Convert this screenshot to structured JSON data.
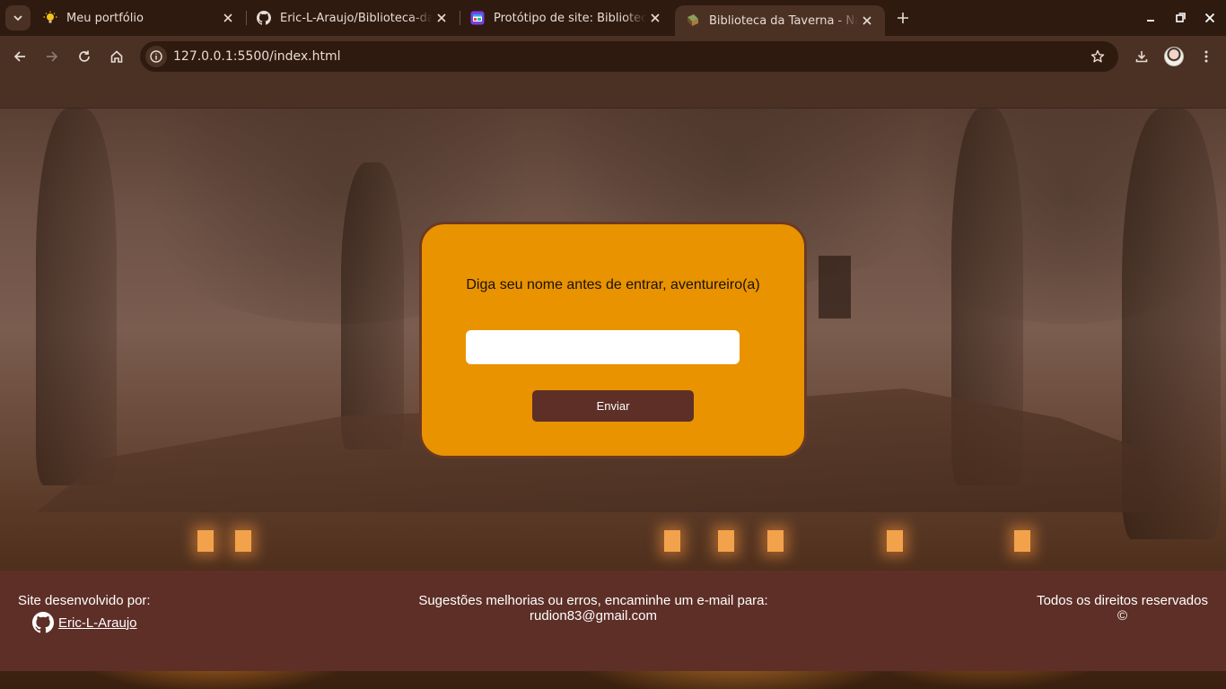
{
  "browser": {
    "tabs": [
      {
        "title": "Meu portfólio",
        "favicon": "lightbulb-icon"
      },
      {
        "title": "Eric-L-Araujo/Biblioteca-da-taverna",
        "favicon": "github-icon"
      },
      {
        "title": "Protótipo de site: Biblioteca da Taverna",
        "favicon": "figma-icon"
      },
      {
        "title": "Biblioteca da Taverna - Na porta",
        "favicon": "book-icon",
        "active": true
      }
    ],
    "url": "127.0.0.1:5500/index.html"
  },
  "modal": {
    "prompt": "Diga seu nome antes de entrar, aventureiro(a)",
    "input_value": "",
    "input_placeholder": "",
    "button_label": "Enviar"
  },
  "footer": {
    "left_label": "Site desenvolvido por:",
    "author_link": "Eric-L-Araujo",
    "center_line1": "Sugestões melhorias ou erros, encaminhe um e-mail para:",
    "center_line2": "rudion83@gmail.com",
    "right_line1": "Todos os direitos reservados",
    "right_line2": "©"
  },
  "colors": {
    "modal_bg": "#e99300",
    "modal_border": "#6a3a24",
    "button_bg": "#5e2f27",
    "footer_bg": "#5e2f27",
    "browser_frame": "#4a3124"
  }
}
